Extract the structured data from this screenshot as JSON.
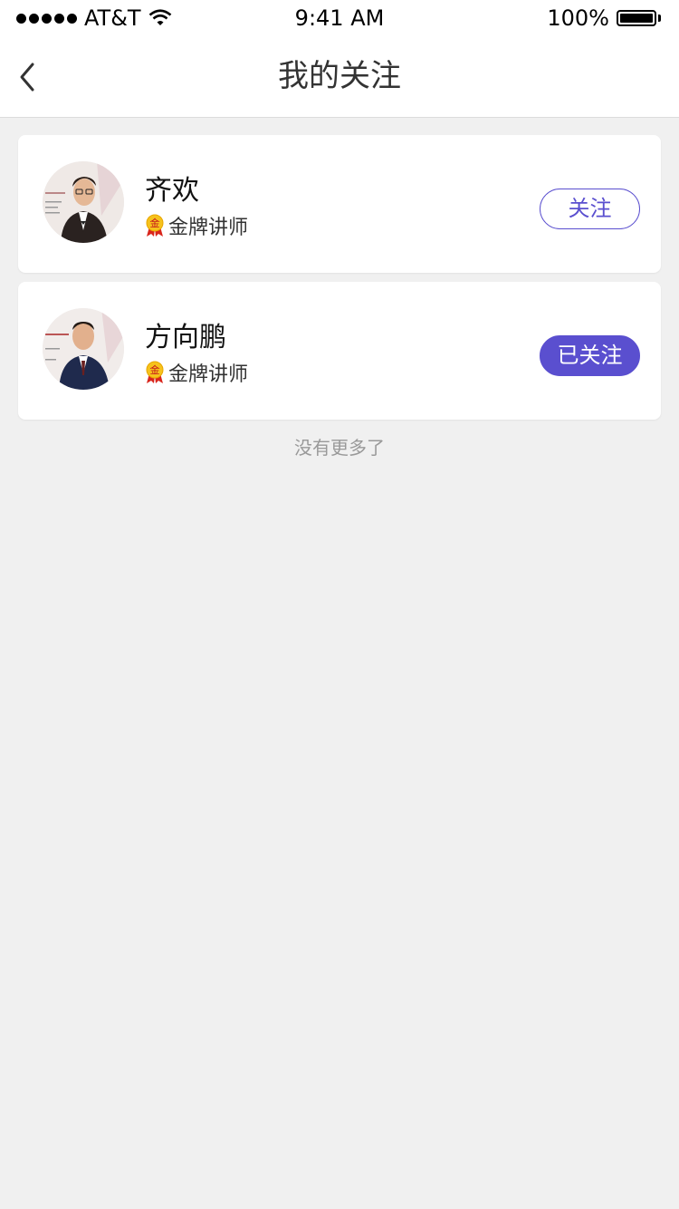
{
  "status_bar": {
    "carrier": "AT&T",
    "time": "9:41 AM",
    "battery": "100%"
  },
  "nav": {
    "title": "我的关注",
    "back_icon": "chevron-left-icon"
  },
  "teachers": [
    {
      "name": "齐欢",
      "title": "金牌讲师",
      "medal_text": "金",
      "follow_label": "关注",
      "followed": false
    },
    {
      "name": "方向鹏",
      "title": "金牌讲师",
      "medal_text": "金",
      "follow_label": "已关注",
      "followed": true
    }
  ],
  "footer_text": "没有更多了",
  "colors": {
    "accent": "#5a4fcf",
    "background": "#f0f0f0"
  }
}
